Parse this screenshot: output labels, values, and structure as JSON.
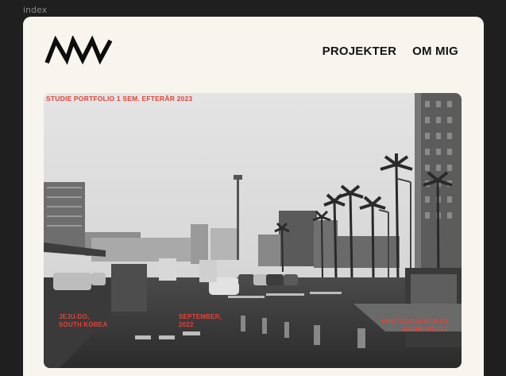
{
  "frame": {
    "label": "index"
  },
  "nav": {
    "projects": "PROJEKTER",
    "about": "OM MIG"
  },
  "hero": {
    "subtitle": "STUDIE PORTFOLIO 1 SEM. EFTERÅR 2023",
    "location": [
      "JEJU-DO,",
      "SOUTH KOREA"
    ],
    "date": [
      "SEPTEMBER,",
      "2022"
    ],
    "credit": [
      "PHOTOGRAPHED BY",
      "MARIE WULFF"
    ]
  },
  "colors": {
    "accent": "#e0443a",
    "background": "#f8f5ee",
    "frame": "#1f1f1f",
    "text": "#141414"
  }
}
